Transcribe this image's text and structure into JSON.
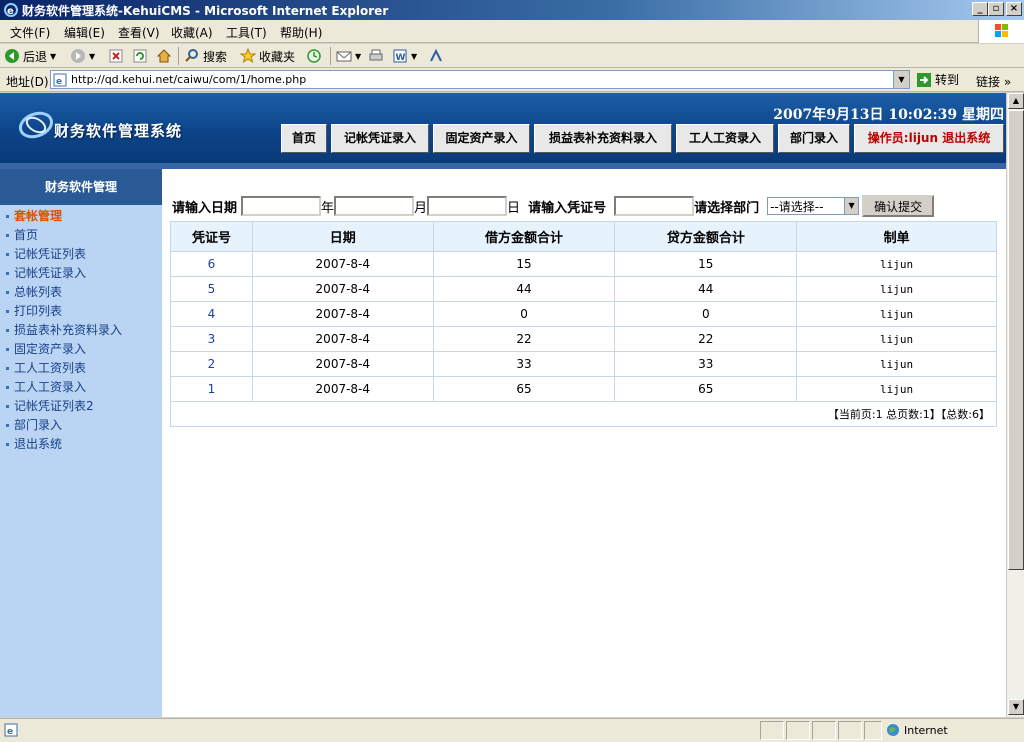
{
  "window": {
    "title": "财务软件管理系统-KehuiCMS - Microsoft Internet Explorer"
  },
  "menu": [
    "文件(F)",
    "编辑(E)",
    "查看(V)",
    "收藏(A)",
    "工具(T)",
    "帮助(H)"
  ],
  "toolbar": {
    "back": "后退",
    "search": "搜索",
    "favorites": "收藏夹"
  },
  "address": {
    "label": "地址(D)",
    "url": "http://qd.kehui.net/caiwu/com/1/home.php",
    "go": "转到",
    "links": "链接"
  },
  "header": {
    "site_name": "财务软件管理系统",
    "datetime": "2007年9月13日  10:02:39  星期四",
    "nav": [
      "首页",
      "记帐凭证录入",
      "固定资产录入",
      "损益表补充资料录入",
      "工人工资录入",
      "部门录入"
    ],
    "operator": "操作员:lijun 退出系统"
  },
  "sidebar": {
    "heading": "财务软件管理",
    "items": [
      "套帐管理",
      "首页",
      "记帐凭证列表",
      "记帐凭证录入",
      "总帐列表",
      "打印列表",
      "损益表补充资料录入",
      "固定资产录入",
      "工人工资列表",
      "工人工资录入",
      "记帐凭证列表2",
      "部门录入",
      "退出系统"
    ],
    "active_index": 0
  },
  "filter": {
    "date_label": "请输入日期",
    "year_suffix": "年",
    "month_suffix": "月",
    "day_suffix": "日",
    "voucher_label": "请输入凭证号",
    "dept_label": "请选择部门",
    "dept_selected": "--请选择--",
    "submit": "确认提交"
  },
  "table": {
    "headers": [
      "凭证号",
      "日期",
      "借方金额合计",
      "贷方金额合计",
      "制单"
    ],
    "rows": [
      [
        "6",
        "2007-8-4",
        "15",
        "15",
        "lijun"
      ],
      [
        "5",
        "2007-8-4",
        "44",
        "44",
        "lijun"
      ],
      [
        "4",
        "2007-8-4",
        "0",
        "0",
        "lijun"
      ],
      [
        "3",
        "2007-8-4",
        "22",
        "22",
        "lijun"
      ],
      [
        "2",
        "2007-8-4",
        "33",
        "33",
        "lijun"
      ],
      [
        "1",
        "2007-8-4",
        "65",
        "65",
        "lijun"
      ]
    ],
    "pagination": "【当前页:1 总页数:1】【总数:6】"
  },
  "status": {
    "zone": "Internet"
  },
  "colors": {
    "banner": "#0d4489",
    "sidebar_bg": "#b9d5f3",
    "active_item": "#e05000",
    "operator": "#c00000",
    "table_header": "#e6f3fc"
  }
}
